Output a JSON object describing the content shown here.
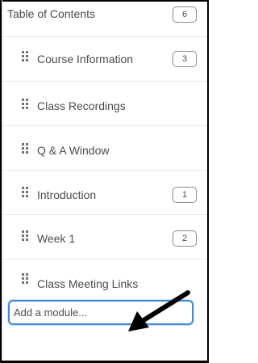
{
  "toc": {
    "label": "Table of Contents",
    "count": "6"
  },
  "modules": [
    {
      "label": "Course Information",
      "count": "3"
    },
    {
      "label": "Class Recordings",
      "count": ""
    },
    {
      "label": "Q & A Window",
      "count": ""
    },
    {
      "label": "Introduction",
      "count": "1"
    },
    {
      "label": "Week 1",
      "count": "2"
    },
    {
      "label": "Class Meeting Links",
      "count": ""
    }
  ],
  "add_module": {
    "label": "Add a module..."
  },
  "colors": {
    "focus_border": "#3f8ad8",
    "text": "#494c4e",
    "arrow": "#000000"
  },
  "icons": {
    "drag_handle": "drag-handle-icon",
    "pointer": "arrow-icon"
  }
}
